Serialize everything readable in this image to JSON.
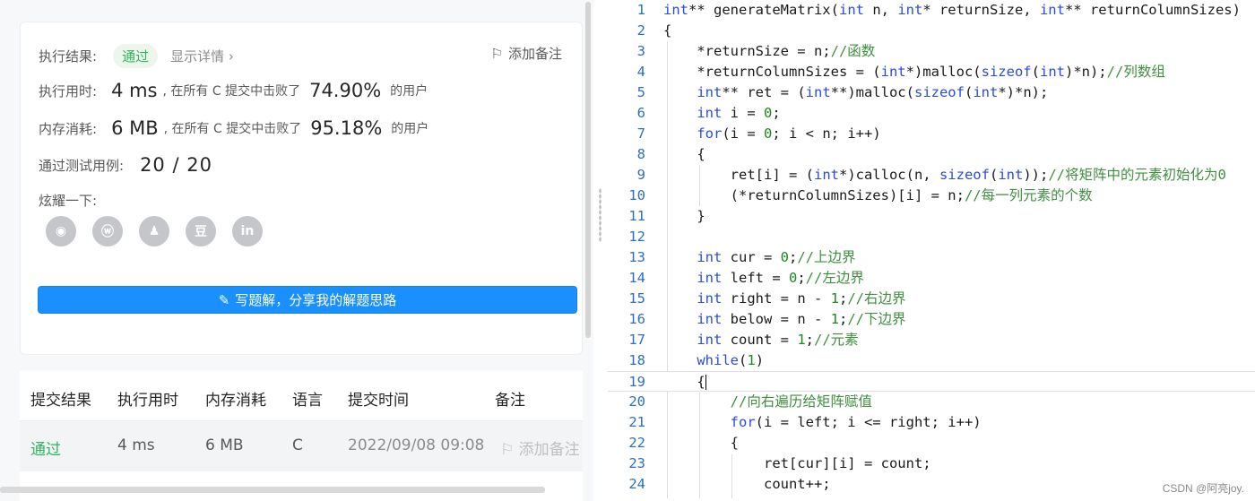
{
  "result": {
    "label_result": "执行结果:",
    "status": "通过",
    "detail": "显示详情",
    "add_note": "添加备注",
    "label_time": "执行用时:",
    "time_value": "4 ms",
    "time_text": ", 在所有 C 提交中击败了",
    "time_pct": "74.90%",
    "time_suffix": "的用户",
    "label_mem": "内存消耗:",
    "mem_value": "6 MB",
    "mem_text": ", 在所有 C 提交中击败了",
    "mem_pct": "95.18%",
    "mem_suffix": "的用户",
    "label_tests": "通过测试用例:",
    "tests_value": "20 / 20",
    "label_share": "炫耀一下:",
    "share_icons": [
      "wechat-icon",
      "weibo-icon",
      "qq-icon",
      "douban-icon",
      "linkedin-icon"
    ],
    "share_glyphs": [
      "◉",
      "ⓦ",
      "♟",
      "豆",
      "in"
    ],
    "write_button": "写题解，分享我的解题思路"
  },
  "table": {
    "headers": [
      "提交结果",
      "执行用时",
      "内存消耗",
      "语言",
      "提交时间",
      "备注"
    ],
    "row": {
      "status": "通过",
      "time": "4 ms",
      "memory": "6 MB",
      "lang": "C",
      "submitted": "2022/09/08 09:08",
      "note": "添加备注"
    }
  },
  "colors": {
    "accent": "#1a90ff",
    "success": "#2db55d",
    "keyword": "#2a4be0",
    "comment": "#3f8f3f",
    "number": "#1a8a1a"
  },
  "code_lines": [
    {
      "n": "1",
      "t": "int** generateMatrix(int n, int* returnSize, int** returnColumnSizes)"
    },
    {
      "n": "2",
      "t": "{"
    },
    {
      "n": "3",
      "t": "    *returnSize = n;//函数"
    },
    {
      "n": "4",
      "t": "    *returnColumnSizes = (int*)malloc(sizeof(int)*n);//列数组"
    },
    {
      "n": "5",
      "t": "    int** ret = (int**)malloc(sizeof(int*)*n);"
    },
    {
      "n": "6",
      "t": "    int i = 0;"
    },
    {
      "n": "7",
      "t": "    for(i = 0; i < n; i++)"
    },
    {
      "n": "8",
      "t": "    {"
    },
    {
      "n": "9",
      "t": "        ret[i] = (int*)calloc(n, sizeof(int));//将矩阵中的元素初始化为0"
    },
    {
      "n": "10",
      "t": "        (*returnColumnSizes)[i] = n;//每一列元素的个数"
    },
    {
      "n": "11",
      "t": "    }"
    },
    {
      "n": "12",
      "t": ""
    },
    {
      "n": "13",
      "t": "    int cur = 0;//上边界"
    },
    {
      "n": "14",
      "t": "    int left = 0;//左边界"
    },
    {
      "n": "15",
      "t": "    int right = n - 1;//右边界"
    },
    {
      "n": "16",
      "t": "    int below = n - 1;//下边界"
    },
    {
      "n": "17",
      "t": "    int count = 1;//元素"
    },
    {
      "n": "18",
      "t": "    while(1)"
    },
    {
      "n": "19",
      "t": "    {"
    },
    {
      "n": "20",
      "t": "        //向右遍历给矩阵赋值"
    },
    {
      "n": "21",
      "t": "        for(i = left; i <= right; i++)"
    },
    {
      "n": "22",
      "t": "        {"
    },
    {
      "n": "23",
      "t": "            ret[cur][i] = count;"
    },
    {
      "n": "24",
      "t": "            count++;"
    }
  ],
  "watermark": "CSDN @阿亮joy."
}
